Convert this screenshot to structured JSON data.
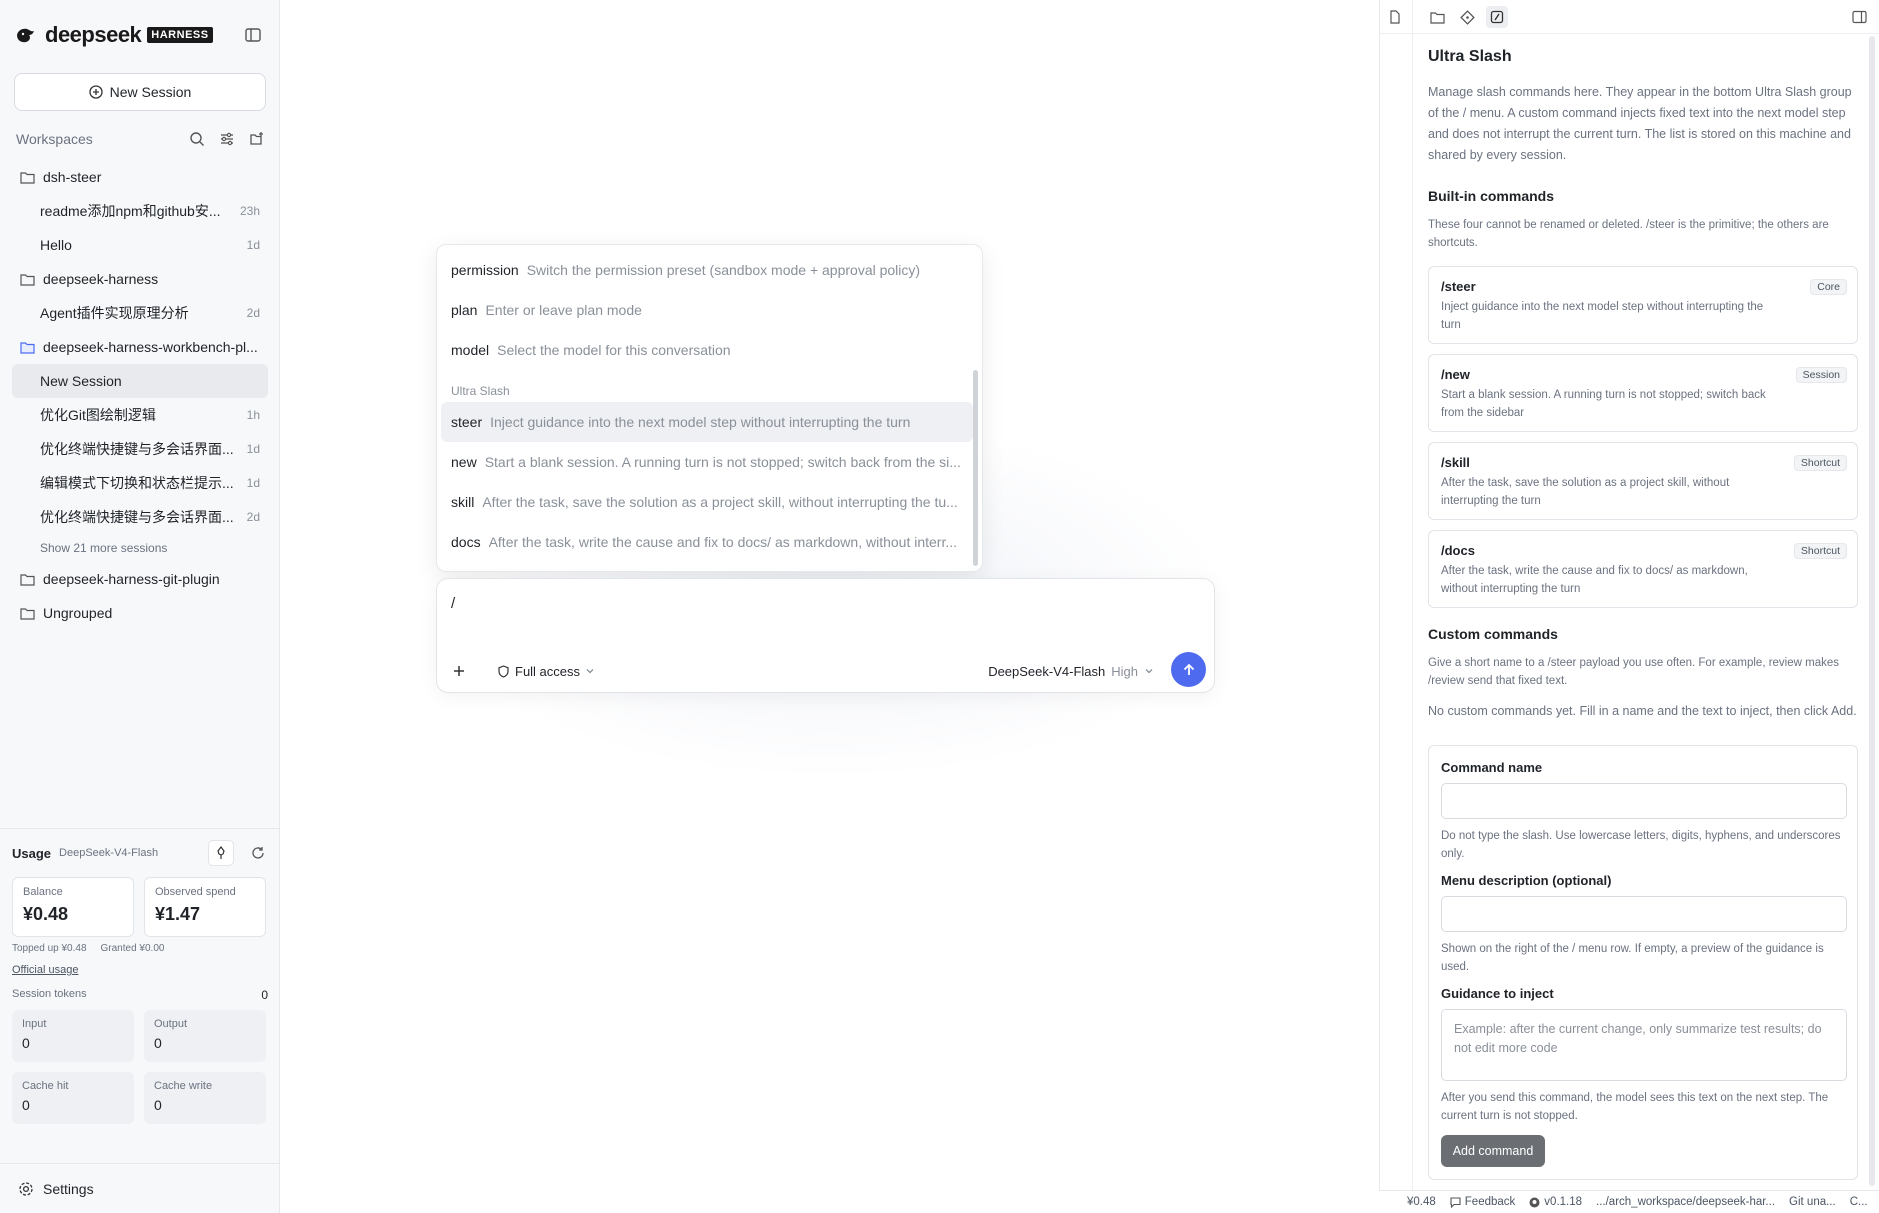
{
  "brand": {
    "name": "deepseek",
    "tag": "HARNESS"
  },
  "sidebar": {
    "new_session_label": "New Session",
    "workspaces_label": "Workspaces",
    "tree": [
      {
        "kind": "folder",
        "name": "dsh-steer"
      },
      {
        "kind": "session",
        "name": "readme添加npm和github安...",
        "age": "23h"
      },
      {
        "kind": "session",
        "name": "Hello",
        "age": "1d"
      },
      {
        "kind": "folder",
        "name": "deepseek-harness"
      },
      {
        "kind": "session",
        "name": "Agent插件实现原理分析",
        "age": "2d"
      },
      {
        "kind": "folder",
        "name": "deepseek-harness-workbench-pl...",
        "open": true
      },
      {
        "kind": "session",
        "name": "New Session",
        "age": "",
        "active": true
      },
      {
        "kind": "session",
        "name": "优化Git图绘制逻辑",
        "age": "1h"
      },
      {
        "kind": "session",
        "name": "优化终端快捷键与多会话界面...",
        "age": "1d"
      },
      {
        "kind": "session",
        "name": "编辑模式下切换和状态栏提示...",
        "age": "1d"
      },
      {
        "kind": "session",
        "name": "优化终端快捷键与多会话界面...",
        "age": "2d"
      },
      {
        "kind": "more",
        "name": "Show 21 more sessions"
      },
      {
        "kind": "folder",
        "name": "deepseek-harness-git-plugin"
      },
      {
        "kind": "folder",
        "name": "Ungrouped"
      }
    ],
    "usage": {
      "label": "Usage",
      "model": "DeepSeek-V4-Flash",
      "balance_label": "Balance",
      "balance": "¥0.48",
      "spend_label": "Observed spend",
      "spend": "¥1.47",
      "topped": "Topped up ¥0.48",
      "granted": "Granted ¥0.00",
      "official": "Official usage",
      "tokens_label": "Session tokens",
      "tokens_total": "0",
      "input_label": "Input",
      "input": "0",
      "output_label": "Output",
      "output": "0",
      "cache_hit_label": "Cache hit",
      "cache_hit": "0",
      "cache_write_label": "Cache write",
      "cache_write": "0"
    },
    "settings_label": "Settings"
  },
  "slash_menu": {
    "items": [
      {
        "cmd": "permission",
        "desc": "Switch the permission preset (sandbox mode + approval policy)"
      },
      {
        "cmd": "plan",
        "desc": "Enter or leave plan mode"
      },
      {
        "cmd": "model",
        "desc": "Select the model for this conversation"
      }
    ],
    "group_label": "Ultra Slash",
    "ultra_items": [
      {
        "cmd": "steer",
        "desc": "Inject guidance into the next model step without interrupting the turn",
        "selected": true
      },
      {
        "cmd": "new",
        "desc": "Start a blank session. A running turn is not stopped; switch back from the si..."
      },
      {
        "cmd": "skill",
        "desc": "After the task, save the solution as a project skill, without interrupting the tu..."
      },
      {
        "cmd": "docs",
        "desc": "After the task, write the cause and fix to docs/ as markdown, without interr..."
      }
    ]
  },
  "composer": {
    "text": "/",
    "access_label": "Full access",
    "model": "DeepSeek-V4-Flash",
    "effort": "High"
  },
  "panel": {
    "title": "Ultra Slash",
    "intro": "Manage slash commands here. They appear in the bottom Ultra Slash group of the / menu. A custom command injects fixed text into the next model step and does not interrupt the current turn. The list is stored on this machine and shared by every session.",
    "builtin_title": "Built-in commands",
    "builtin_desc": "These four cannot be renamed or deleted. /steer is the primitive; the others are shortcuts.",
    "builtins": [
      {
        "name": "/steer",
        "tag": "Core",
        "desc": "Inject guidance into the next model step without interrupting the turn"
      },
      {
        "name": "/new",
        "tag": "Session",
        "desc": "Start a blank session. A running turn is not stopped; switch back from the sidebar"
      },
      {
        "name": "/skill",
        "tag": "Shortcut",
        "desc": "After the task, save the solution as a project skill, without interrupting the turn"
      },
      {
        "name": "/docs",
        "tag": "Shortcut",
        "desc": "After the task, write the cause and fix to docs/ as markdown, without interrupting the turn"
      }
    ],
    "custom_title": "Custom commands",
    "custom_desc": "Give a short name to a /steer payload you use often. For example, review makes /review send that fixed text.",
    "empty_note": "No custom commands yet. Fill in a name and the text to inject, then click Add.",
    "form": {
      "name_label": "Command name",
      "name_value": "",
      "name_hint": "Do not type the slash. Use lowercase letters, digits, hyphens, and underscores only.",
      "desc_label": "Menu description (optional)",
      "desc_value": "",
      "desc_hint": "Shown on the right of the / menu row. If empty, a preview of the guidance is used.",
      "guidance_label": "Guidance to inject",
      "guidance_placeholder": "Example: after the current change, only summarize test results; do not edit more code",
      "guidance_hint": "After you send this command, the model sees this text on the next step. The current turn is not stopped.",
      "add_label": "Add command"
    }
  },
  "statusbar": {
    "balance": "¥0.48",
    "feedback": "Feedback",
    "version": "v0.1.18",
    "path": ".../arch_workspace/deepseek-har...",
    "git": "Git una...",
    "more": "C..."
  }
}
